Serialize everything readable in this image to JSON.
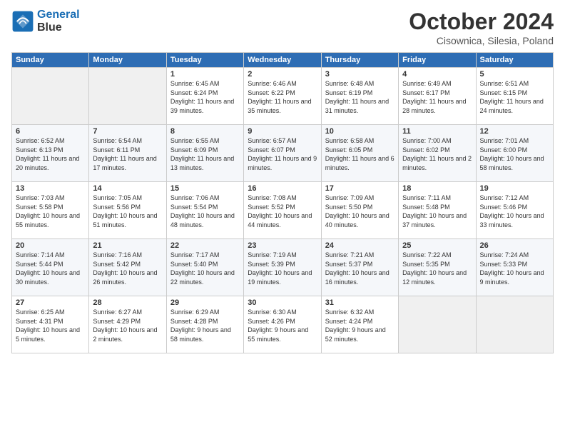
{
  "logo": {
    "line1": "General",
    "line2": "Blue"
  },
  "title": "October 2024",
  "location": "Cisownica, Silesia, Poland",
  "weekdays": [
    "Sunday",
    "Monday",
    "Tuesday",
    "Wednesday",
    "Thursday",
    "Friday",
    "Saturday"
  ],
  "weeks": [
    [
      {
        "day": "",
        "info": ""
      },
      {
        "day": "",
        "info": ""
      },
      {
        "day": "1",
        "info": "Sunrise: 6:45 AM\nSunset: 6:24 PM\nDaylight: 11 hours\nand 39 minutes."
      },
      {
        "day": "2",
        "info": "Sunrise: 6:46 AM\nSunset: 6:22 PM\nDaylight: 11 hours\nand 35 minutes."
      },
      {
        "day": "3",
        "info": "Sunrise: 6:48 AM\nSunset: 6:19 PM\nDaylight: 11 hours\nand 31 minutes."
      },
      {
        "day": "4",
        "info": "Sunrise: 6:49 AM\nSunset: 6:17 PM\nDaylight: 11 hours\nand 28 minutes."
      },
      {
        "day": "5",
        "info": "Sunrise: 6:51 AM\nSunset: 6:15 PM\nDaylight: 11 hours\nand 24 minutes."
      }
    ],
    [
      {
        "day": "6",
        "info": "Sunrise: 6:52 AM\nSunset: 6:13 PM\nDaylight: 11 hours\nand 20 minutes."
      },
      {
        "day": "7",
        "info": "Sunrise: 6:54 AM\nSunset: 6:11 PM\nDaylight: 11 hours\nand 17 minutes."
      },
      {
        "day": "8",
        "info": "Sunrise: 6:55 AM\nSunset: 6:09 PM\nDaylight: 11 hours\nand 13 minutes."
      },
      {
        "day": "9",
        "info": "Sunrise: 6:57 AM\nSunset: 6:07 PM\nDaylight: 11 hours\nand 9 minutes."
      },
      {
        "day": "10",
        "info": "Sunrise: 6:58 AM\nSunset: 6:05 PM\nDaylight: 11 hours\nand 6 minutes."
      },
      {
        "day": "11",
        "info": "Sunrise: 7:00 AM\nSunset: 6:02 PM\nDaylight: 11 hours\nand 2 minutes."
      },
      {
        "day": "12",
        "info": "Sunrise: 7:01 AM\nSunset: 6:00 PM\nDaylight: 10 hours\nand 58 minutes."
      }
    ],
    [
      {
        "day": "13",
        "info": "Sunrise: 7:03 AM\nSunset: 5:58 PM\nDaylight: 10 hours\nand 55 minutes."
      },
      {
        "day": "14",
        "info": "Sunrise: 7:05 AM\nSunset: 5:56 PM\nDaylight: 10 hours\nand 51 minutes."
      },
      {
        "day": "15",
        "info": "Sunrise: 7:06 AM\nSunset: 5:54 PM\nDaylight: 10 hours\nand 48 minutes."
      },
      {
        "day": "16",
        "info": "Sunrise: 7:08 AM\nSunset: 5:52 PM\nDaylight: 10 hours\nand 44 minutes."
      },
      {
        "day": "17",
        "info": "Sunrise: 7:09 AM\nSunset: 5:50 PM\nDaylight: 10 hours\nand 40 minutes."
      },
      {
        "day": "18",
        "info": "Sunrise: 7:11 AM\nSunset: 5:48 PM\nDaylight: 10 hours\nand 37 minutes."
      },
      {
        "day": "19",
        "info": "Sunrise: 7:12 AM\nSunset: 5:46 PM\nDaylight: 10 hours\nand 33 minutes."
      }
    ],
    [
      {
        "day": "20",
        "info": "Sunrise: 7:14 AM\nSunset: 5:44 PM\nDaylight: 10 hours\nand 30 minutes."
      },
      {
        "day": "21",
        "info": "Sunrise: 7:16 AM\nSunset: 5:42 PM\nDaylight: 10 hours\nand 26 minutes."
      },
      {
        "day": "22",
        "info": "Sunrise: 7:17 AM\nSunset: 5:40 PM\nDaylight: 10 hours\nand 22 minutes."
      },
      {
        "day": "23",
        "info": "Sunrise: 7:19 AM\nSunset: 5:39 PM\nDaylight: 10 hours\nand 19 minutes."
      },
      {
        "day": "24",
        "info": "Sunrise: 7:21 AM\nSunset: 5:37 PM\nDaylight: 10 hours\nand 16 minutes."
      },
      {
        "day": "25",
        "info": "Sunrise: 7:22 AM\nSunset: 5:35 PM\nDaylight: 10 hours\nand 12 minutes."
      },
      {
        "day": "26",
        "info": "Sunrise: 7:24 AM\nSunset: 5:33 PM\nDaylight: 10 hours\nand 9 minutes."
      }
    ],
    [
      {
        "day": "27",
        "info": "Sunrise: 6:25 AM\nSunset: 4:31 PM\nDaylight: 10 hours\nand 5 minutes."
      },
      {
        "day": "28",
        "info": "Sunrise: 6:27 AM\nSunset: 4:29 PM\nDaylight: 10 hours\nand 2 minutes."
      },
      {
        "day": "29",
        "info": "Sunrise: 6:29 AM\nSunset: 4:28 PM\nDaylight: 9 hours\nand 58 minutes."
      },
      {
        "day": "30",
        "info": "Sunrise: 6:30 AM\nSunset: 4:26 PM\nDaylight: 9 hours\nand 55 minutes."
      },
      {
        "day": "31",
        "info": "Sunrise: 6:32 AM\nSunset: 4:24 PM\nDaylight: 9 hours\nand 52 minutes."
      },
      {
        "day": "",
        "info": ""
      },
      {
        "day": "",
        "info": ""
      }
    ]
  ]
}
